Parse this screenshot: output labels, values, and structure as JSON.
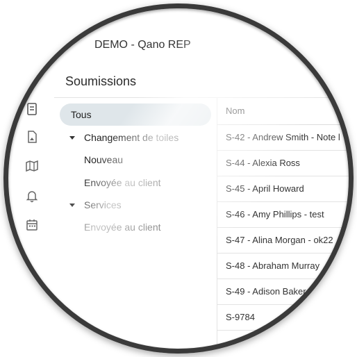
{
  "header": {
    "app_title": "DEMO - Qano REP"
  },
  "page": {
    "title": "Soumissions"
  },
  "rail": {
    "icons": [
      "document-icon",
      "image-document-icon",
      "map-icon",
      "bell-icon",
      "calendar-icon"
    ]
  },
  "tree": {
    "all": "Tous",
    "groups": [
      {
        "label": "Changement de toiles",
        "children": [
          "Nouveau",
          "Envoyée au client"
        ]
      },
      {
        "label": "Services",
        "children": [
          "Envoyée au client"
        ]
      }
    ]
  },
  "table": {
    "column_header": "Nom",
    "rows": [
      "S-42 - Andrew Smith - Note l",
      "S-44 - Alexia Ross",
      "S-45 - April Howard",
      "S-46 - Amy Phillips - test",
      "S-47 - Alina Morgan - ok22",
      "S-48 - Abraham Murray",
      "S-49 - Adison Baker",
      "S-9784"
    ]
  }
}
